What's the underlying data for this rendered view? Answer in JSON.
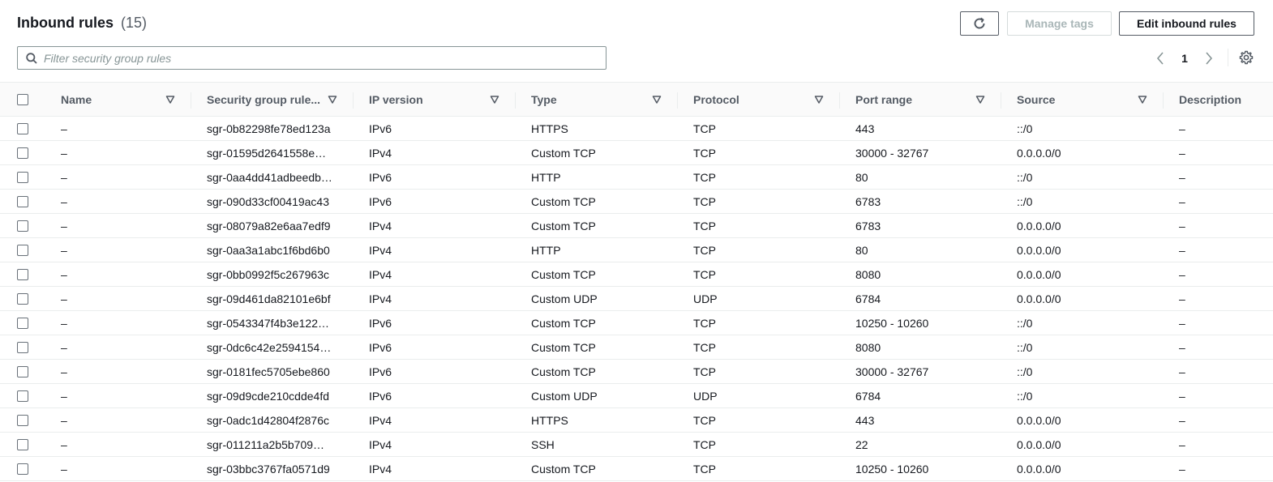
{
  "header": {
    "title": "Inbound rules",
    "count": "(15)",
    "manage_tags_label": "Manage tags",
    "edit_inbound_label": "Edit inbound rules",
    "refresh_icon": "refresh-icon"
  },
  "search": {
    "placeholder": "Filter security group rules",
    "value": ""
  },
  "pagination": {
    "current_page": "1"
  },
  "columns": {
    "name": "Name",
    "sgr": "Security group rule...",
    "ip_version": "IP version",
    "type": "Type",
    "protocol": "Protocol",
    "port_range": "Port range",
    "source": "Source",
    "description": "Description"
  },
  "rows": [
    {
      "name": "–",
      "sgr": "sgr-0b82298fe78ed123a",
      "ipv": "IPv6",
      "type": "HTTPS",
      "proto": "TCP",
      "port": "443",
      "src": "::/0",
      "desc": "–"
    },
    {
      "name": "–",
      "sgr": "sgr-01595d2641558e…",
      "ipv": "IPv4",
      "type": "Custom TCP",
      "proto": "TCP",
      "port": "30000 - 32767",
      "src": "0.0.0.0/0",
      "desc": "–"
    },
    {
      "name": "–",
      "sgr": "sgr-0aa4dd41adbeedb…",
      "ipv": "IPv6",
      "type": "HTTP",
      "proto": "TCP",
      "port": "80",
      "src": "::/0",
      "desc": "–"
    },
    {
      "name": "–",
      "sgr": "sgr-090d33cf00419ac43",
      "ipv": "IPv6",
      "type": "Custom TCP",
      "proto": "TCP",
      "port": "6783",
      "src": "::/0",
      "desc": "–"
    },
    {
      "name": "–",
      "sgr": "sgr-08079a82e6aa7edf9",
      "ipv": "IPv4",
      "type": "Custom TCP",
      "proto": "TCP",
      "port": "6783",
      "src": "0.0.0.0/0",
      "desc": "–"
    },
    {
      "name": "–",
      "sgr": "sgr-0aa3a1abc1f6bd6b0",
      "ipv": "IPv4",
      "type": "HTTP",
      "proto": "TCP",
      "port": "80",
      "src": "0.0.0.0/0",
      "desc": "–"
    },
    {
      "name": "–",
      "sgr": "sgr-0bb0992f5c267963c",
      "ipv": "IPv4",
      "type": "Custom TCP",
      "proto": "TCP",
      "port": "8080",
      "src": "0.0.0.0/0",
      "desc": "–"
    },
    {
      "name": "–",
      "sgr": "sgr-09d461da82101e6bf",
      "ipv": "IPv4",
      "type": "Custom UDP",
      "proto": "UDP",
      "port": "6784",
      "src": "0.0.0.0/0",
      "desc": "–"
    },
    {
      "name": "–",
      "sgr": "sgr-0543347f4b3e122…",
      "ipv": "IPv6",
      "type": "Custom TCP",
      "proto": "TCP",
      "port": "10250 - 10260",
      "src": "::/0",
      "desc": "–"
    },
    {
      "name": "–",
      "sgr": "sgr-0dc6c42e2594154…",
      "ipv": "IPv6",
      "type": "Custom TCP",
      "proto": "TCP",
      "port": "8080",
      "src": "::/0",
      "desc": "–"
    },
    {
      "name": "–",
      "sgr": "sgr-0181fec5705ebe860",
      "ipv": "IPv6",
      "type": "Custom TCP",
      "proto": "TCP",
      "port": "30000 - 32767",
      "src": "::/0",
      "desc": "–"
    },
    {
      "name": "–",
      "sgr": "sgr-09d9cde210cdde4fd",
      "ipv": "IPv6",
      "type": "Custom UDP",
      "proto": "UDP",
      "port": "6784",
      "src": "::/0",
      "desc": "–"
    },
    {
      "name": "–",
      "sgr": "sgr-0adc1d42804f2876c",
      "ipv": "IPv4",
      "type": "HTTPS",
      "proto": "TCP",
      "port": "443",
      "src": "0.0.0.0/0",
      "desc": "–"
    },
    {
      "name": "–",
      "sgr": "sgr-011211a2b5b709…",
      "ipv": "IPv4",
      "type": "SSH",
      "proto": "TCP",
      "port": "22",
      "src": "0.0.0.0/0",
      "desc": "–"
    },
    {
      "name": "–",
      "sgr": "sgr-03bbc3767fa0571d9",
      "ipv": "IPv4",
      "type": "Custom TCP",
      "proto": "TCP",
      "port": "10250 - 10260",
      "src": "0.0.0.0/0",
      "desc": "–"
    }
  ]
}
